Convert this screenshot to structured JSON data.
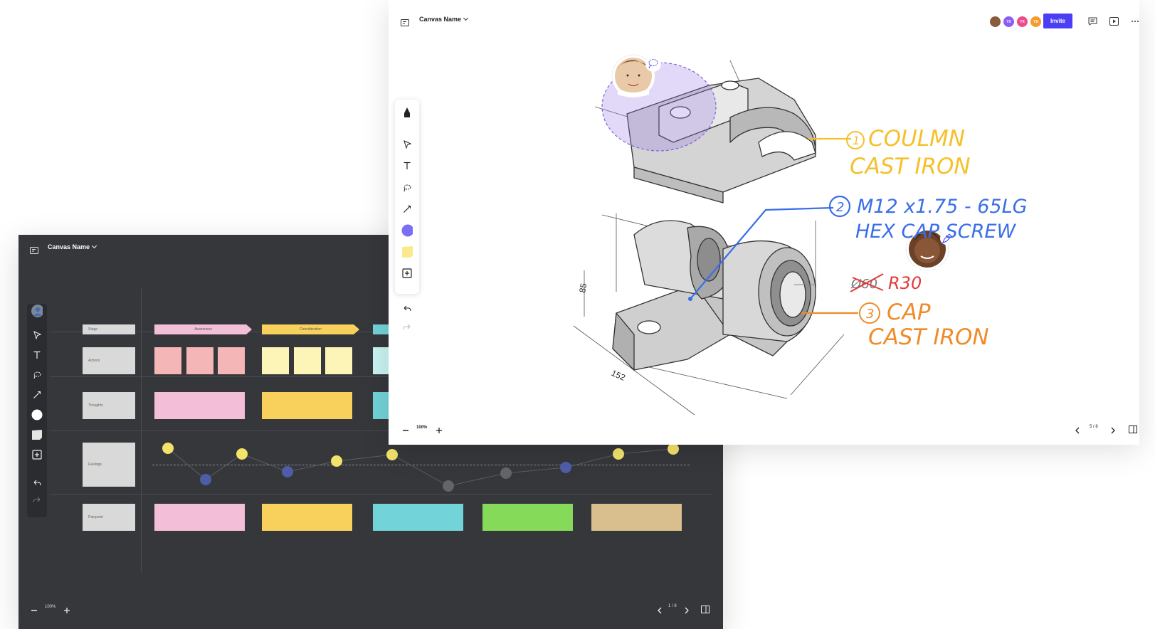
{
  "dark_board": {
    "canvas_name": "Canvas Name",
    "zoom": "100%",
    "page": "1 / 8",
    "row_labels": [
      "Stage",
      "Actions",
      "Thoughts",
      "Feelings",
      "Painpoint"
    ],
    "stages": [
      "Awareness",
      "Consideration"
    ],
    "colors": {
      "background": "#35373b",
      "pink": "#f3bfd8",
      "salmon": "#f4b6b7",
      "yellow": "#f8d15d",
      "cream": "#fdf4b8",
      "teal": "#72d3d8",
      "green": "#86da5a",
      "tan": "#d9be8e"
    }
  },
  "light_canvas": {
    "canvas_name": "Canvas Name",
    "invite_label": "Invite",
    "zoom": "100%",
    "page": "5 / 8",
    "collaborators": [
      {
        "initials": "",
        "color": "#8a5a3c"
      },
      {
        "initials": "YX",
        "color": "#8b5cf6"
      },
      {
        "initials": "YX",
        "color": "#ef4a8a"
      },
      {
        "initials": "YX",
        "color": "#f59b2e"
      }
    ],
    "accent": "#4a3ff5",
    "annotations": {
      "a1_num": "1",
      "a1_line1": "COULMN",
      "a1_line2": "CAST IRON",
      "a2_num": "2",
      "a2_line1": "M12 x1.75 - 65LG",
      "a2_line2": "HEX CAP SCREW",
      "a_strike": "Ø60",
      "a_r30": "R30",
      "a3_num": "3",
      "a3_line1": "CAP",
      "a3_line2": "CAST IRON",
      "dim_85": "85",
      "dim_152": "152"
    }
  }
}
